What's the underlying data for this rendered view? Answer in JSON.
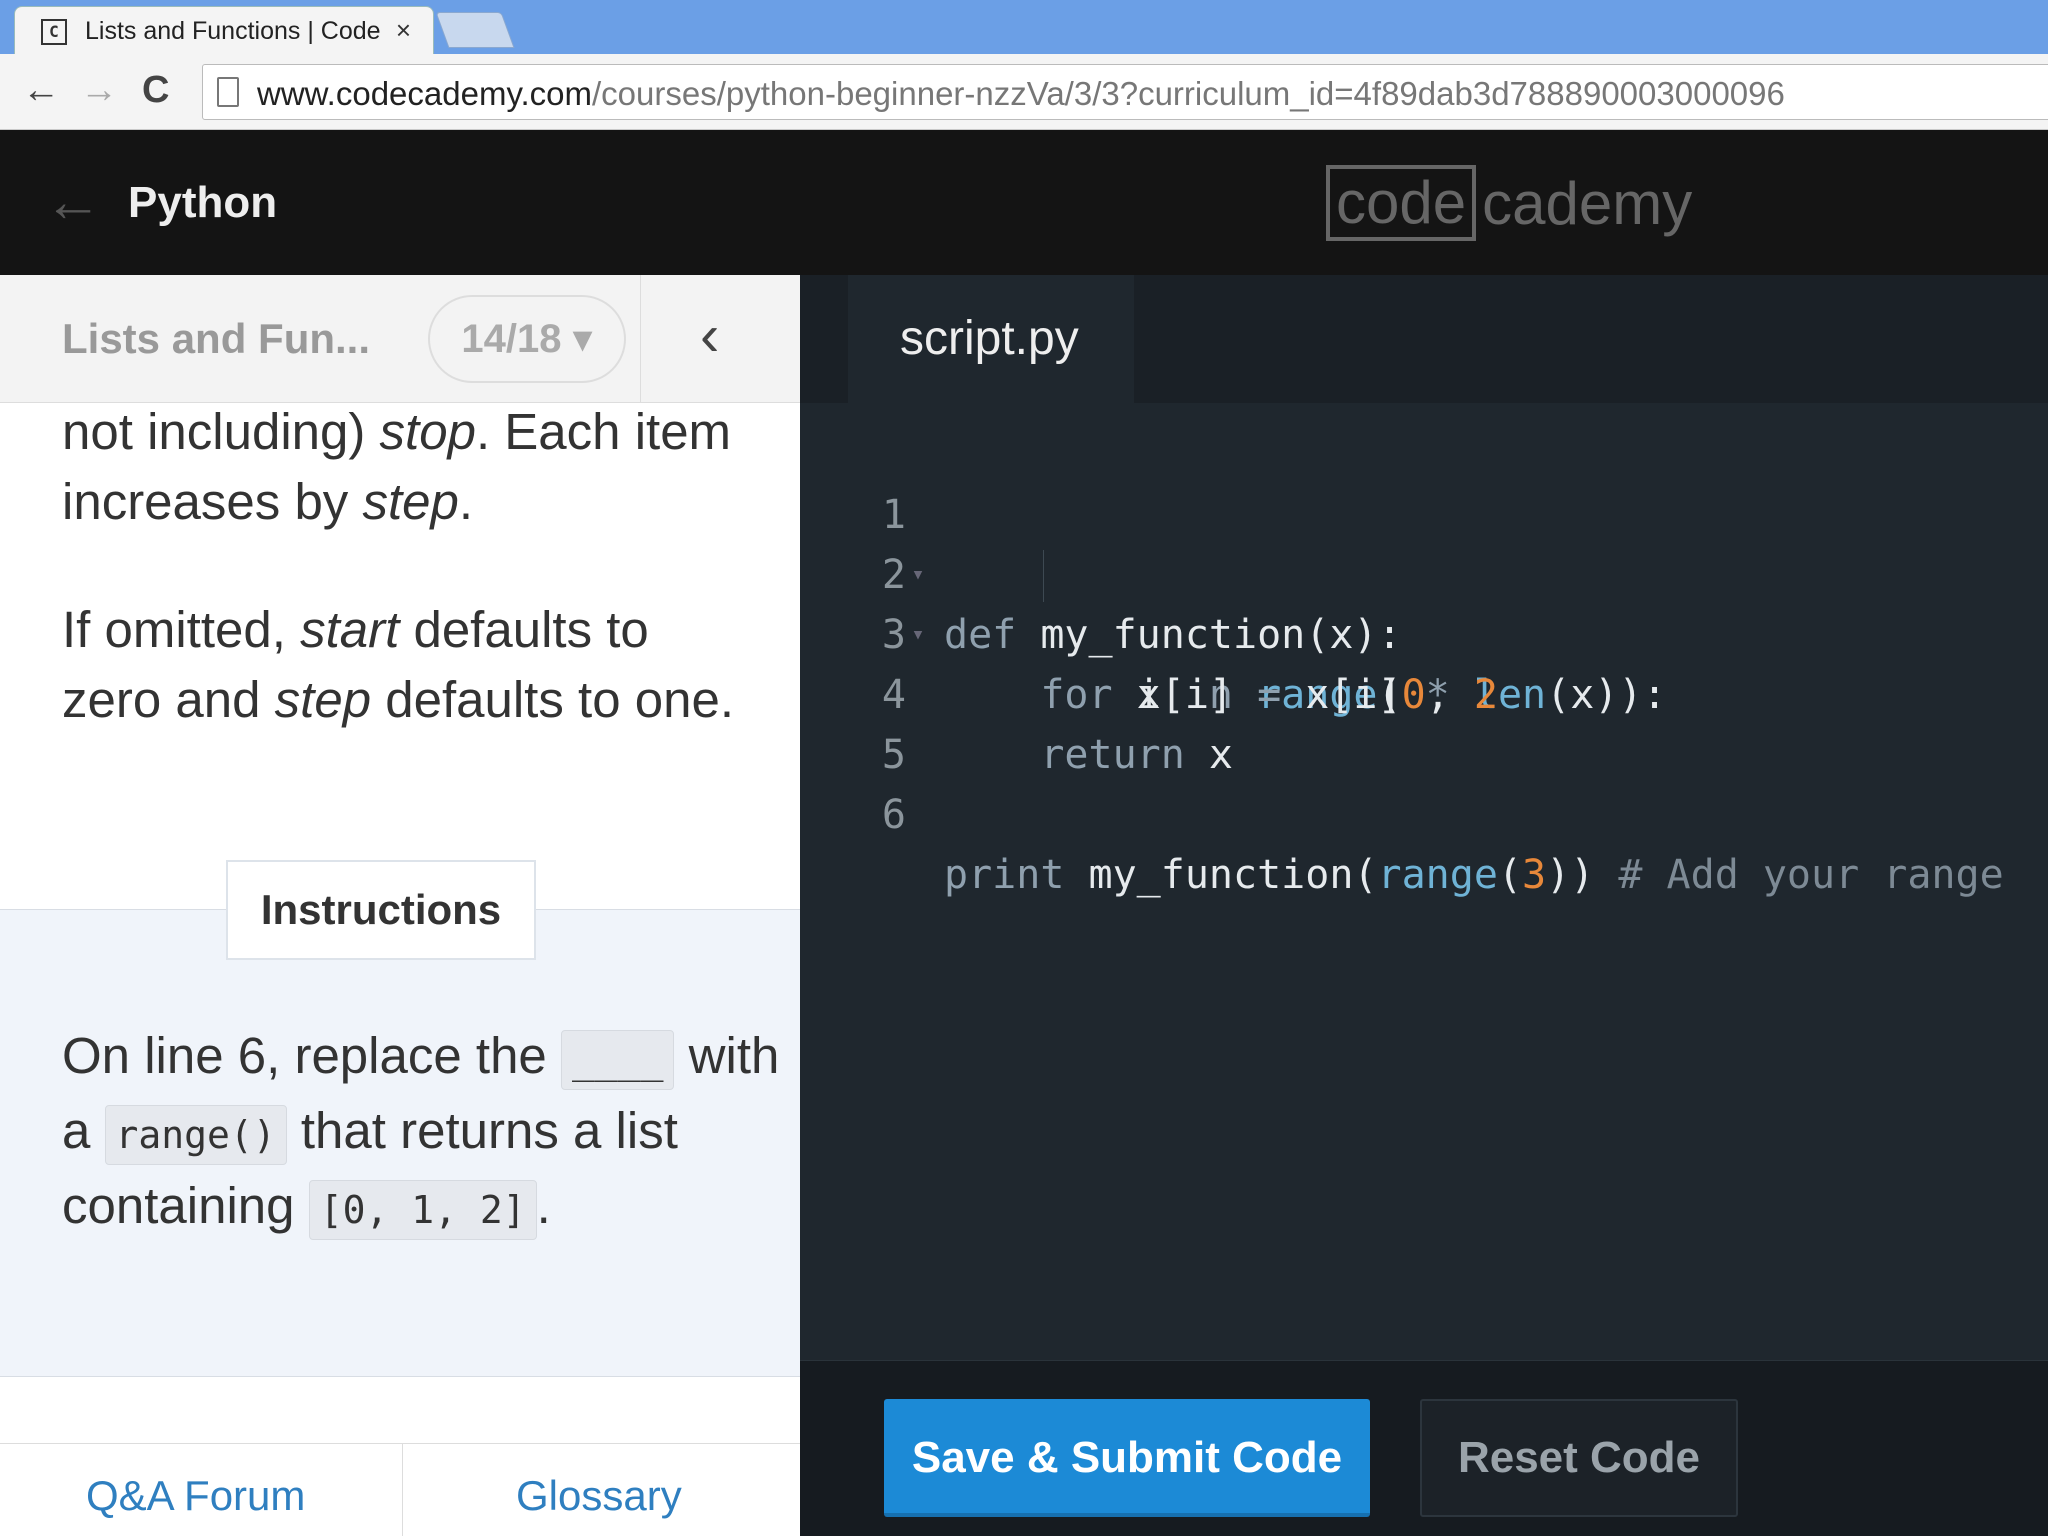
{
  "browser": {
    "tab_title": "Lists and Functions | Code",
    "tab_close": "×",
    "url_host": "www.codecademy.com",
    "url_path": "/courses/python-beginner-nzzVa/3/3?curriculum_id=4f89dab3d788890003000096",
    "back": "←",
    "forward": "→",
    "reload": "C"
  },
  "header": {
    "back_arrow": "←",
    "course_title": "Python",
    "logo_boxed": "code",
    "logo_rest": "cademy"
  },
  "lesson": {
    "name": "Lists and Fun...",
    "progress": "14/18 ▾",
    "collapse": "‹",
    "para1": {
      "a": "not including) ",
      "stop": "stop",
      "b": ". Each item increases by ",
      "step": "step",
      "c": "."
    },
    "para2": {
      "a": "If omitted, ",
      "start": "start",
      "b": " defaults to zero and ",
      "step": "step",
      "c": " defaults to one."
    },
    "instructions_tab": "Instructions",
    "instructions": {
      "a": "On line 6, replace the ",
      "blank": "____",
      "b": " with a ",
      "code1": "range()",
      "c": " that returns a list containing ",
      "code2": "[0, 1, 2]",
      "d": "."
    },
    "footer_qa": "Q&A Forum",
    "footer_glossary": "Glossary"
  },
  "editor": {
    "file_tab": "script.py",
    "lines": [
      {
        "n": "1",
        "fold": "▾"
      },
      {
        "n": "2",
        "fold": "▾"
      },
      {
        "n": "3",
        "fold": ""
      },
      {
        "n": "4",
        "fold": ""
      },
      {
        "n": "5",
        "fold": ""
      },
      {
        "n": "6",
        "fold": ""
      }
    ],
    "tokens": {
      "l1": [
        "def",
        " my_function(x):"
      ],
      "l2": [
        "    for",
        " i ",
        "in",
        " range",
        "(",
        "0",
        ", ",
        "len",
        "(x)):"
      ],
      "l3": [
        "        x[i] ",
        "=",
        " x[i] ",
        "*",
        " ",
        "2"
      ],
      "l4": [
        "    return",
        " x"
      ],
      "l6": [
        "print",
        " my_function(",
        "range",
        "(",
        "3",
        ")) ",
        "# Add your range"
      ]
    },
    "submit_label": "Save & Submit Code",
    "reset_label": "Reset Code"
  }
}
